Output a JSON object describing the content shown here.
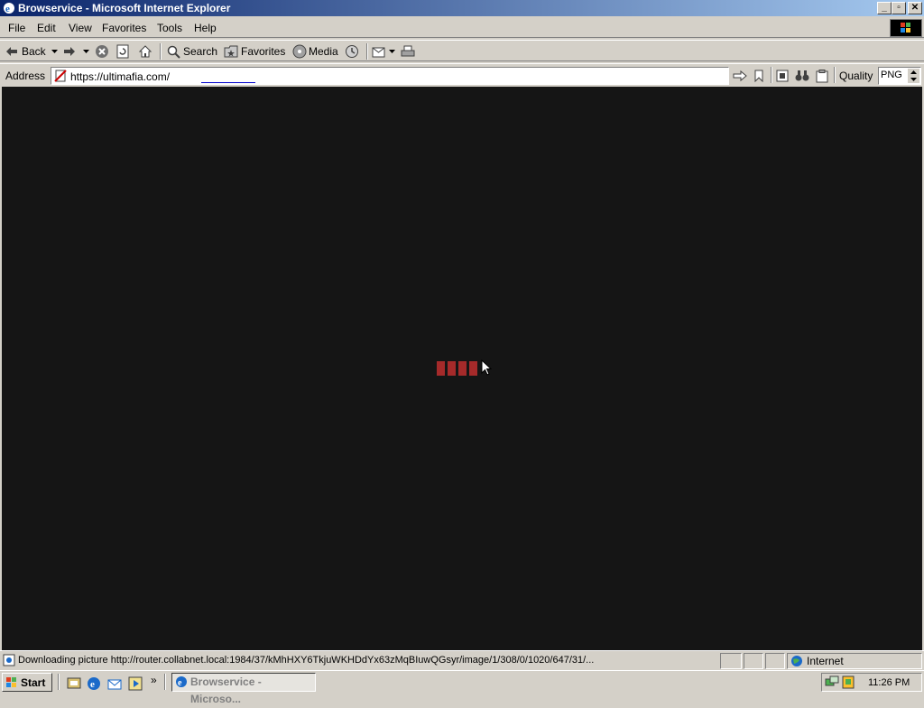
{
  "window": {
    "title": "Browservice - Microsoft Internet Explorer",
    "minimize": "_",
    "restore": "▫",
    "close": "✕"
  },
  "menu": [
    "File",
    "Edit",
    "View",
    "Favorites",
    "Tools",
    "Help"
  ],
  "toolbar": {
    "back": "Back",
    "search": "Search",
    "favorites": "Favorites",
    "media": "Media"
  },
  "address": {
    "label": "Address",
    "url": "https://ultimafia.com/"
  },
  "quality": {
    "label": "Quality",
    "value": "PNG"
  },
  "status": {
    "text": "Downloading picture http://router.collabnet.local:1984/37/kMhHXY6TkjuWKHDdYx63zMqBIuwQGsyr/image/1/308/0/1020/647/31/...",
    "zone": "Internet"
  },
  "taskbar": {
    "start": "Start",
    "chevron": "»",
    "task_label": "Browservice - Microso...",
    "clock": "11:26 PM"
  },
  "colors": {
    "page_background": "#151515",
    "loader": "#a52a2a",
    "titlebar": "#0a246a"
  }
}
